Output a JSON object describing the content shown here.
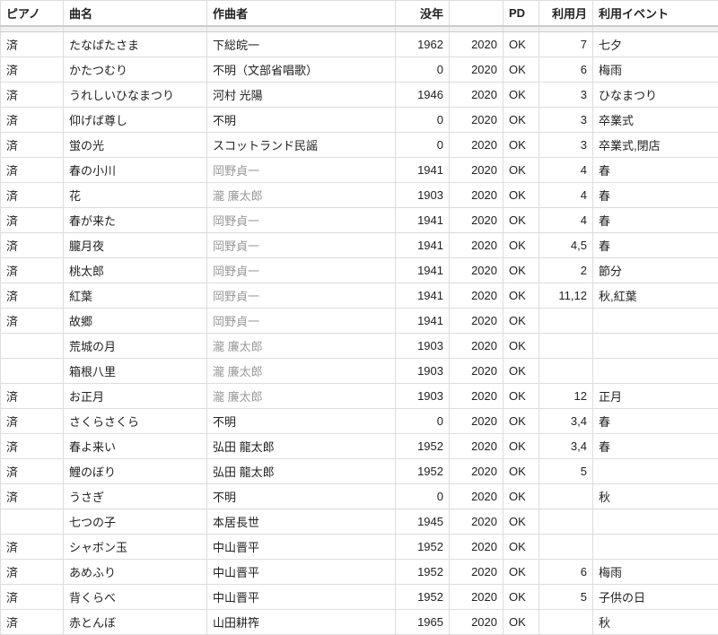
{
  "headers": {
    "piano": "ピアノ",
    "title": "曲名",
    "composer": "作曲者",
    "death_year": "没年",
    "year2": "",
    "pd": "PD",
    "month": "利用月",
    "event": "利用イベント"
  },
  "muted_composers": [
    "岡野貞一",
    "瀧 廉太郎"
  ],
  "rows": [
    {
      "piano": "済",
      "title": "たなばたさま",
      "composer": "下総皖一",
      "death_year": "1962",
      "year2": "2020",
      "pd": "OK",
      "month": "7",
      "event": "七夕"
    },
    {
      "piano": "済",
      "title": "かたつむり",
      "composer": "不明（文部省唱歌）",
      "death_year": "0",
      "year2": "2020",
      "pd": "OK",
      "month": "6",
      "event": "梅雨"
    },
    {
      "piano": "済",
      "title": "うれしいひなまつり",
      "composer": "河村 光陽",
      "death_year": "1946",
      "year2": "2020",
      "pd": "OK",
      "month": "3",
      "event": "ひなまつり"
    },
    {
      "piano": "済",
      "title": "仰げば尊し",
      "composer": "不明",
      "death_year": "0",
      "year2": "2020",
      "pd": "OK",
      "month": "3",
      "event": "卒業式"
    },
    {
      "piano": "済",
      "title": "蛍の光",
      "composer": "スコットランド民謡",
      "death_year": "0",
      "year2": "2020",
      "pd": "OK",
      "month": "3",
      "event": "卒業式,閉店"
    },
    {
      "piano": "済",
      "title": "春の小川",
      "composer": "岡野貞一",
      "death_year": "1941",
      "year2": "2020",
      "pd": "OK",
      "month": "4",
      "event": "春"
    },
    {
      "piano": "済",
      "title": "花",
      "composer": "瀧 廉太郎",
      "death_year": "1903",
      "year2": "2020",
      "pd": "OK",
      "month": "4",
      "event": "春"
    },
    {
      "piano": "済",
      "title": "春が来た",
      "composer": "岡野貞一",
      "death_year": "1941",
      "year2": "2020",
      "pd": "OK",
      "month": "4",
      "event": "春"
    },
    {
      "piano": "済",
      "title": "朧月夜",
      "composer": "岡野貞一",
      "death_year": "1941",
      "year2": "2020",
      "pd": "OK",
      "month": "4,5",
      "event": "春"
    },
    {
      "piano": "済",
      "title": "桃太郎",
      "composer": "岡野貞一",
      "death_year": "1941",
      "year2": "2020",
      "pd": "OK",
      "month": "2",
      "event": "節分"
    },
    {
      "piano": "済",
      "title": "紅葉",
      "composer": "岡野貞一",
      "death_year": "1941",
      "year2": "2020",
      "pd": "OK",
      "month": "11,12",
      "event": "秋,紅葉"
    },
    {
      "piano": "済",
      "title": "故郷",
      "composer": "岡野貞一",
      "death_year": "1941",
      "year2": "2020",
      "pd": "OK",
      "month": "",
      "event": ""
    },
    {
      "piano": "",
      "title": "荒城の月",
      "composer": "瀧 廉太郎",
      "death_year": "1903",
      "year2": "2020",
      "pd": "OK",
      "month": "",
      "event": ""
    },
    {
      "piano": "",
      "title": "箱根八里",
      "composer": "瀧 廉太郎",
      "death_year": "1903",
      "year2": "2020",
      "pd": "OK",
      "month": "",
      "event": ""
    },
    {
      "piano": "済",
      "title": "お正月",
      "composer": "瀧 廉太郎",
      "death_year": "1903",
      "year2": "2020",
      "pd": "OK",
      "month": "12",
      "event": "正月"
    },
    {
      "piano": "済",
      "title": "さくらさくら",
      "composer": "不明",
      "death_year": "0",
      "year2": "2020",
      "pd": "OK",
      "month": "3,4",
      "event": "春"
    },
    {
      "piano": "済",
      "title": "春よ来い",
      "composer": "弘田 龍太郎",
      "death_year": "1952",
      "year2": "2020",
      "pd": "OK",
      "month": "3,4",
      "event": "春"
    },
    {
      "piano": "済",
      "title": "鯉のぼり",
      "composer": "弘田 龍太郎",
      "death_year": "1952",
      "year2": "2020",
      "pd": "OK",
      "month": "5",
      "event": ""
    },
    {
      "piano": "済",
      "title": "うさぎ",
      "composer": "不明",
      "death_year": "0",
      "year2": "2020",
      "pd": "OK",
      "month": "",
      "event": "秋"
    },
    {
      "piano": "",
      "title": "七つの子",
      "composer": "本居長世",
      "death_year": "1945",
      "year2": "2020",
      "pd": "OK",
      "month": "",
      "event": ""
    },
    {
      "piano": "済",
      "title": "シャボン玉",
      "composer": "中山晋平",
      "death_year": "1952",
      "year2": "2020",
      "pd": "OK",
      "month": "",
      "event": ""
    },
    {
      "piano": "済",
      "title": "あめふり",
      "composer": "中山晋平",
      "death_year": "1952",
      "year2": "2020",
      "pd": "OK",
      "month": "6",
      "event": "梅雨"
    },
    {
      "piano": "済",
      "title": "背くらべ",
      "composer": "中山晋平",
      "death_year": "1952",
      "year2": "2020",
      "pd": "OK",
      "month": "5",
      "event": "子供の日"
    },
    {
      "piano": "済",
      "title": "赤とんぼ",
      "composer": "山田耕筰",
      "death_year": "1965",
      "year2": "2020",
      "pd": "OK",
      "month": "",
      "event": "秋"
    }
  ]
}
